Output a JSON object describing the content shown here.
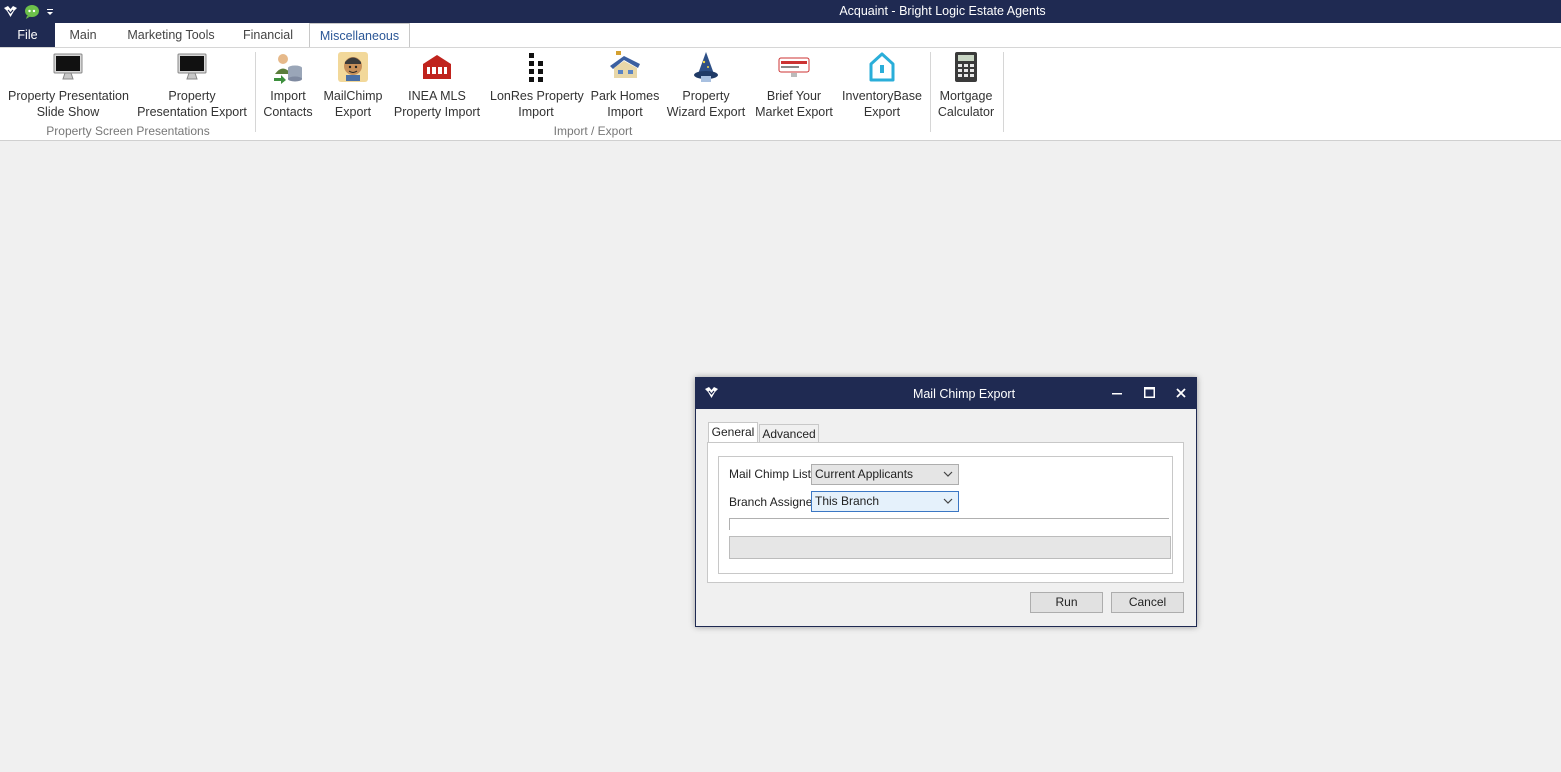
{
  "app": {
    "title": "Acquaint - Bright Logic Estate Agents",
    "quick_access": [
      "app-logo-icon",
      "chat-bubble-icon",
      "dropdown-arrow-icon"
    ]
  },
  "tabs": [
    {
      "label": "File"
    },
    {
      "label": "Main"
    },
    {
      "label": "Marketing Tools"
    },
    {
      "label": "Financial"
    },
    {
      "label": "Miscellaneous",
      "active": true
    }
  ],
  "ribbon": {
    "groups": [
      {
        "label": "Property Screen Presentations"
      },
      {
        "label": "Import / Export"
      }
    ],
    "buttons": [
      {
        "line1": "Property Presentation",
        "line2": "Slide Show",
        "icon": "monitor-icon"
      },
      {
        "line1": "Property",
        "line2": "Presentation Export",
        "icon": "monitor-icon"
      },
      {
        "line1": "Import",
        "line2": "Contacts",
        "icon": "contacts-database-icon"
      },
      {
        "line1": "MailChimp",
        "line2": "Export",
        "icon": "mailchimp-icon"
      },
      {
        "line1": "INEA MLS",
        "line2": "Property Import",
        "icon": "inea-icon"
      },
      {
        "line1": "LonRes Property",
        "line2": "Import",
        "icon": "lonres-icon"
      },
      {
        "line1": "Park Homes",
        "line2": "Import",
        "icon": "park-homes-icon"
      },
      {
        "line1": "Property",
        "line2": "Wizard Export",
        "icon": "wizard-hat-icon"
      },
      {
        "line1": "Brief Your",
        "line2": "Market Export",
        "icon": "brief-your-market-icon"
      },
      {
        "line1": "InventoryBase",
        "line2": "Export",
        "icon": "house-outline-icon"
      },
      {
        "line1": "Mortgage",
        "line2": "Calculator",
        "icon": "calculator-icon"
      }
    ]
  },
  "dialog": {
    "title": "Mail Chimp Export",
    "tabs": [
      {
        "label": "General",
        "active": true
      },
      {
        "label": "Advanced"
      }
    ],
    "fields": {
      "list_label": "Mail Chimp List",
      "list_value": "Current Applicants",
      "branch_label": "Branch Assigned",
      "branch_value": "This Branch"
    },
    "buttons": {
      "run": "Run",
      "cancel": "Cancel"
    }
  },
  "colors": {
    "titlebar": "#1f2a52",
    "accent_tab": "#2b5797",
    "background": "#f0f0f0"
  }
}
